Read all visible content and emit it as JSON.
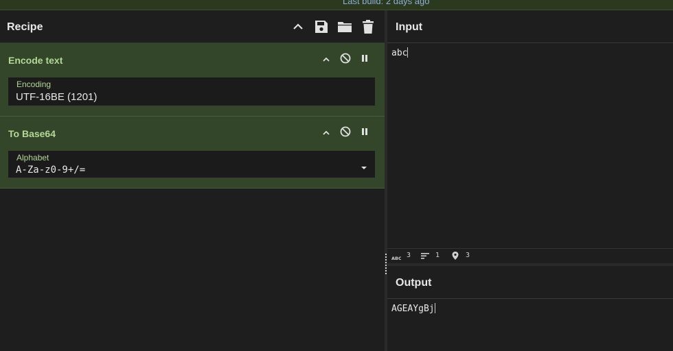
{
  "topbar": {
    "build_text": "Last build: 2 days ago"
  },
  "recipe": {
    "title": "Recipe",
    "icons": [
      "chevron-up-icon",
      "save-icon",
      "folder-icon",
      "trash-icon"
    ],
    "operations": [
      {
        "title": "Encode text",
        "field_label": "Encoding",
        "field_value": "UTF-16BE (1201)"
      },
      {
        "title": "To Base64",
        "field_label": "Alphabet",
        "field_value": "A-Za-z0-9+/="
      }
    ]
  },
  "input": {
    "title": "Input",
    "text": "abc",
    "stats": {
      "length": "3",
      "lines": "1",
      "position": "3"
    }
  },
  "output": {
    "title": "Output",
    "text": "AGEAYgBj"
  },
  "colors": {
    "operation_bg": "#34462a",
    "operation_title": "#b4d896",
    "panel_bg": "#1e1e1e",
    "link_blue": "#8fb0d8"
  }
}
